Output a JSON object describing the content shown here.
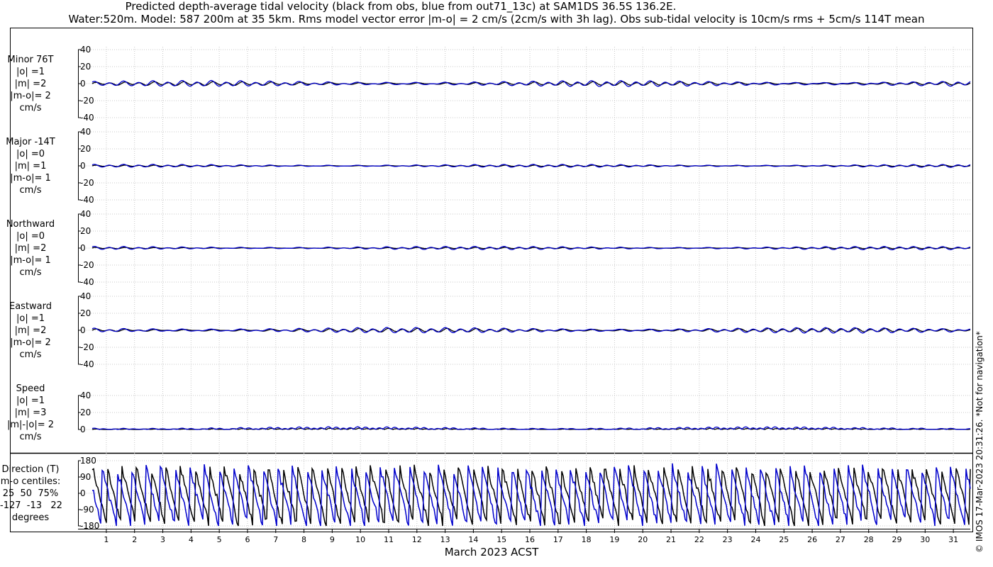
{
  "title_line1": "Predicted depth-average tidal velocity (black from obs, blue from out71_13c) at SAM1DS 36.5S 136.2E.",
  "title_line2": "Water:520m. Model: 587 200m at 35 5km. Rms model vector error |m-o| = 2 cm/s (2cm/s with 3h lag). Obs sub-tidal velocity is 10cm/s rms + 5cm/s 114T mean",
  "copyright": "© IMOS 17-Mar-2023 20:31:26. *Not for navigation*",
  "chart_data": {
    "type": "line",
    "xlabel": "March 2023 ACST",
    "x_ticks": [
      "1",
      "2",
      "3",
      "4",
      "5",
      "6",
      "7",
      "8",
      "9",
      "10",
      "11",
      "12",
      "13",
      "14",
      "15",
      "16",
      "17",
      "18",
      "19",
      "20",
      "21",
      "22",
      "23",
      "24",
      "25",
      "26",
      "27",
      "28",
      "29",
      "30",
      "31"
    ],
    "series_colors": {
      "obs": "#000000",
      "model": "#0000cc"
    },
    "panels": [
      {
        "id": "minor",
        "label_lines": [
          "Minor 76T",
          "|o| =1",
          "|m| =2",
          "|m-o|= 2",
          "cm/s"
        ],
        "yticks": [
          40,
          20,
          0,
          -20,
          -40
        ],
        "ylim": [
          -40,
          40
        ],
        "obs_amp": 1.8,
        "model_amp": 2.8
      },
      {
        "id": "major",
        "label_lines": [
          "Major -14T",
          "|o| =0",
          "|m| =1",
          "|m-o|= 1",
          "cm/s"
        ],
        "yticks": [
          40,
          20,
          0,
          -20,
          -40
        ],
        "ylim": [
          -40,
          40
        ],
        "obs_amp": 0.7,
        "model_amp": 1.4
      },
      {
        "id": "northward",
        "label_lines": [
          "Northward",
          "|o| =0",
          "|m| =2",
          "|m-o|= 1",
          "cm/s"
        ],
        "yticks": [
          40,
          20,
          0,
          -20,
          -40
        ],
        "ylim": [
          -40,
          40
        ],
        "obs_amp": 0.7,
        "model_amp": 1.6
      },
      {
        "id": "eastward",
        "label_lines": [
          "Eastward",
          "|o| =1",
          "|m| =2",
          "|m-o|= 2",
          "cm/s"
        ],
        "yticks": [
          40,
          20,
          0,
          -20,
          -40
        ],
        "ylim": [
          -40,
          40
        ],
        "obs_amp": 1.8,
        "model_amp": 2.6
      },
      {
        "id": "speed",
        "label_lines": [
          "Speed",
          "|o| =1",
          "|m| =3",
          "|m|-|o|= 2",
          "cm/s"
        ],
        "yticks": [
          40,
          20,
          0
        ],
        "ylim": [
          0,
          40
        ],
        "obs_amp": 1.2,
        "model_amp": 2.5
      },
      {
        "id": "direction",
        "label_lines": [
          "Direction (T)",
          "m-o centiles:",
          "25  50  75%",
          "-127  -13   22",
          "degrees"
        ],
        "yticks": [
          180,
          90,
          0,
          -90,
          -180
        ],
        "ylim": [
          -180,
          180
        ]
      }
    ]
  }
}
